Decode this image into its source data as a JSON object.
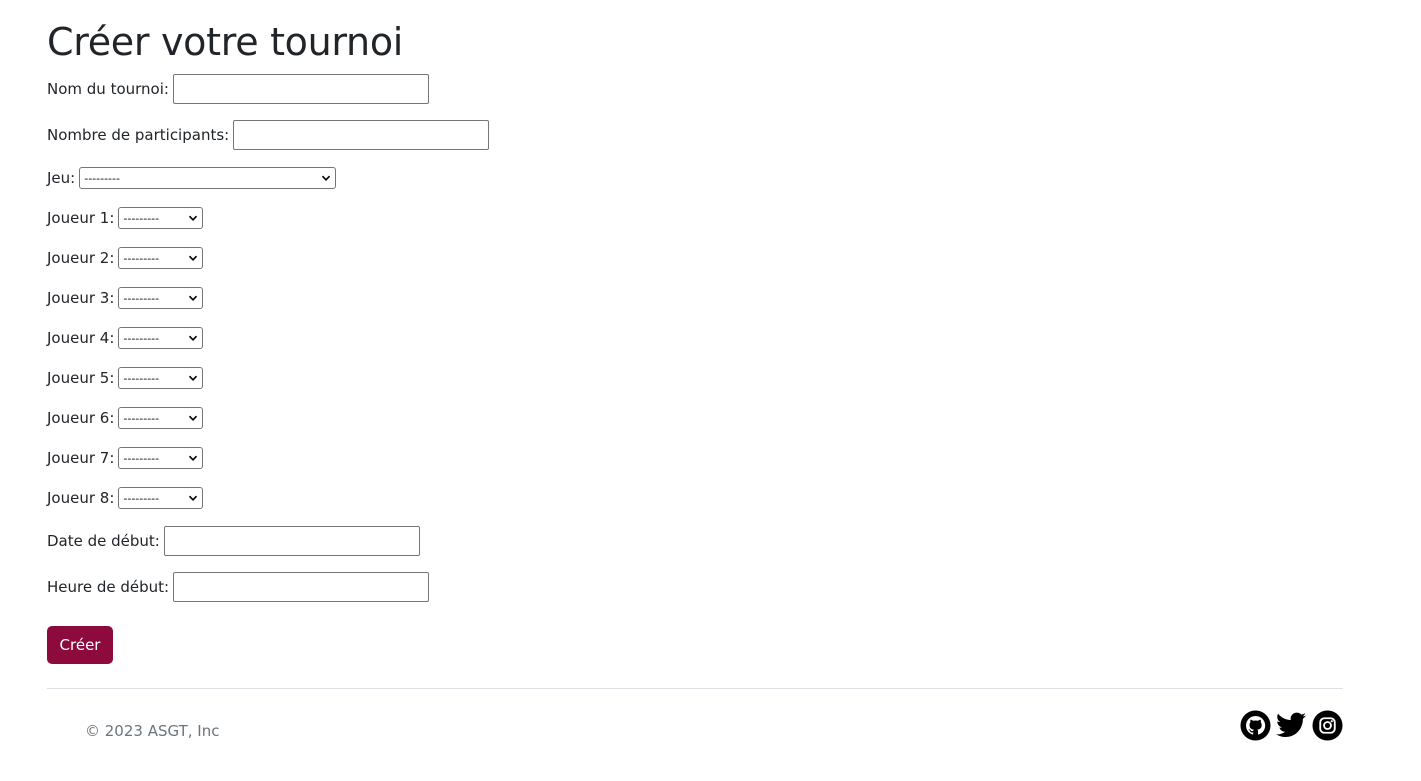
{
  "page": {
    "title": "Créer votre tournoi"
  },
  "form": {
    "tournament_name": {
      "label": "Nom du tournoi:",
      "value": ""
    },
    "participants": {
      "label": "Nombre de participants:",
      "value": ""
    },
    "game": {
      "label": "Jeu:",
      "selected": "---------"
    },
    "players": [
      {
        "label": "Joueur 1:",
        "selected": "---------"
      },
      {
        "label": "Joueur 2:",
        "selected": "---------"
      },
      {
        "label": "Joueur 3:",
        "selected": "---------"
      },
      {
        "label": "Joueur 4:",
        "selected": "---------"
      },
      {
        "label": "Joueur 5:",
        "selected": "---------"
      },
      {
        "label": "Joueur 6:",
        "selected": "---------"
      },
      {
        "label": "Joueur 7:",
        "selected": "---------"
      },
      {
        "label": "Joueur 8:",
        "selected": "---------"
      }
    ],
    "start_date": {
      "label": "Date de début:",
      "value": ""
    },
    "start_time": {
      "label": "Heure de début:",
      "value": ""
    },
    "submit_label": "Créer"
  },
  "footer": {
    "copyright": "© 2023 ASGT, Inc",
    "socials": [
      {
        "icon": "github-icon"
      },
      {
        "icon": "twitter-icon"
      },
      {
        "icon": "instagram-icon"
      }
    ]
  },
  "colors": {
    "accent": "#8c0b3c",
    "text": "#212529",
    "muted": "#6c757d",
    "divider": "#dee2e6"
  }
}
